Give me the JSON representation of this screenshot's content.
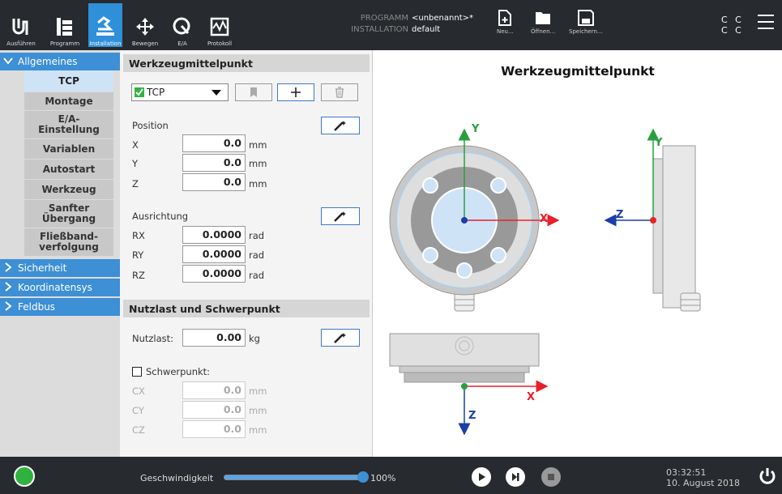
{
  "topbar": {
    "tabs": [
      {
        "label": "Ausführen",
        "icon": "ur-logo-icon"
      },
      {
        "label": "Programm",
        "icon": "program-icon"
      },
      {
        "label": "Installation",
        "icon": "installation-icon"
      },
      {
        "label": "Bewegen",
        "icon": "move-icon"
      },
      {
        "label": "E/A",
        "icon": "io-icon"
      },
      {
        "label": "Protokoll",
        "icon": "log-icon"
      }
    ],
    "program_label": "PROGRAMM",
    "program_value": "<unbenannt>*",
    "installation_label": "INSTALLATION",
    "installation_value": "default",
    "file_buttons": {
      "new": "Neu...",
      "open": "Öffnen...",
      "save": "Speichern..."
    },
    "cc_line1": "C C",
    "cc_line2": "C C"
  },
  "sidebar": {
    "sections": [
      {
        "label": "Allgemeines",
        "expanded": true
      },
      {
        "label": "Sicherheit"
      },
      {
        "label": "Koordinatensys"
      },
      {
        "label": "Feldbus"
      }
    ],
    "items": [
      "TCP",
      "Montage",
      "E/A-\nEinstellung",
      "Variablen",
      "Autostart",
      "Werkzeug",
      "Sanfter\nÜbergang",
      "Fließband-\nverfolgung"
    ]
  },
  "form": {
    "tcp_header": "Werkzeugmittelpunkt",
    "tcp_select": "TCP",
    "position_label": "Position",
    "x_label": "X",
    "x_value": "0.0",
    "y_label": "Y",
    "y_value": "0.0",
    "z_label": "Z",
    "z_value": "0.0",
    "mm": "mm",
    "orientation_label": "Ausrichtung",
    "rx_label": "RX",
    "rx_value": "0.0000",
    "ry_label": "RY",
    "ry_value": "0.0000",
    "rz_label": "RZ",
    "rz_value": "0.0000",
    "rad": "rad",
    "payload_header": "Nutzlast und Schwerpunkt",
    "payload_label": "Nutzlast:",
    "payload_value": "0.00",
    "kg": "kg",
    "cog_label": "Schwerpunkt:",
    "cx_label": "CX",
    "cx_value": "0.0",
    "cy_label": "CY",
    "cy_value": "0.0",
    "cz_label": "CZ",
    "cz_value": "0.0"
  },
  "diagram": {
    "title": "Werkzeugmittelpunkt",
    "axis_x": "X",
    "axis_y": "Y",
    "axis_z": "Z",
    "colors": {
      "x": "#e8202a",
      "y": "#28a040",
      "z": "#1a3fa8"
    }
  },
  "bottombar": {
    "speed_label": "Geschwindigkeit",
    "speed_value": "100%",
    "speed_fraction": 1.0,
    "time": "03:32:51",
    "date": "10. August 2018"
  }
}
